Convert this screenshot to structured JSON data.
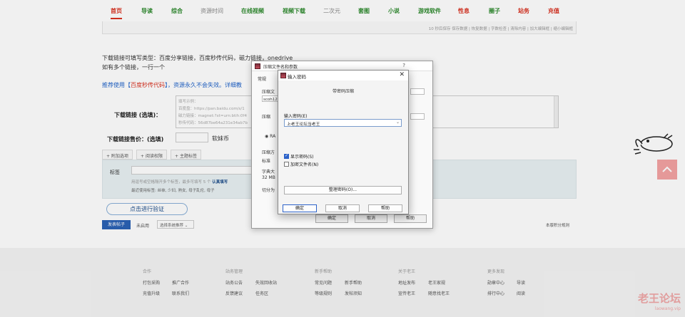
{
  "nav": {
    "items": [
      "首页",
      "导读",
      "综合",
      "资源时间",
      "在线视频",
      "视频下载",
      "二次元",
      "套图",
      "小说",
      "游戏软件",
      "性息",
      "圈子",
      "站务",
      "充值"
    ]
  },
  "topbox": {
    "links": "10 秒后保存 保存数据 | 恢复数据 | 字数检查 | 清除内容 | 加大编辑框 | 缩小编辑框"
  },
  "description": {
    "line1": "下载链接可填写类型：百度分享链接，百度秒传代码，磁力链接，onedrive",
    "line2": "如有多个链接，一行一个"
  },
  "recommend": {
    "prefix": "推荐使用【",
    "link": "百度秒传代码",
    "suffix": "】，资源永久不会失效。详细教"
  },
  "download_link": {
    "label": "下载链接 (选填)：",
    "placeholder_lines": [
      "填写示例：",
      "百度盘：https://pan.baidu.com/s/1",
      "磁力链接：magnet:?xt=urn:btih:0f4",
      "秒传代码：56d87be64a231e34ab7b"
    ]
  },
  "price": {
    "label": "下载链接售价：(选填)",
    "unit": "软妹币"
  },
  "tabs": [
    "附加选项",
    "阅读权限",
    "主题标签"
  ],
  "tags": {
    "label": "标签",
    "hint1": "用逗号或空格隔开多个标签，最多可填写 5 个",
    "hint1_strong": "认真填写",
    "hint2": "最近使用标签: 丝袜, 少妇, 熟女, 母子乱伦, 母子"
  },
  "verify_button": "点击进行验证",
  "post_button": "发表帖子",
  "unlisted_label": "未启用",
  "select_value": "选择系统推荐",
  "rules_link": "本版积分规则",
  "footer": {
    "columns": [
      {
        "title": "合作",
        "links": [
          "打包采购",
          "推广合作",
          "充值升级",
          "联系我们"
        ]
      },
      {
        "title": "站务管理",
        "links": [
          "站务公告",
          "失效回收站",
          "反馈建议",
          "任务区"
        ]
      },
      {
        "title": "新手帮助",
        "links": [
          "常见问题",
          "新手帮助",
          "等级规则",
          "发帖须知"
        ]
      },
      {
        "title": "关于老王",
        "links": [
          "地址发布",
          "老王家规",
          "宣传老王",
          "随意找老王"
        ]
      },
      {
        "title": "更多发现",
        "links": [
          "勋章中心",
          "导读",
          "排行中心",
          "阅读"
        ]
      }
    ]
  },
  "watermark": {
    "main": "老王论坛",
    "sub": "laowang.vip"
  },
  "back_dialog": {
    "title": "压缩文件名和参数",
    "help": "?",
    "tab": "常规",
    "field1_label": "压缩文",
    "field1_value": "scoh12",
    "field2_label": "压缩",
    "radio_label": "RA",
    "field3_label": "压缩方",
    "field3_value": "标准",
    "field4_label": "字典大",
    "field4_value": "32 MB",
    "field5_label": "切分为",
    "ok": "确定",
    "cancel": "取消",
    "help_btn": "帮助"
  },
  "dialog": {
    "title": "输入密码",
    "subtitle": "带密码压缩",
    "password_label": "输入密码(E)",
    "password_value": "上老王论坛当老王",
    "show_password": "显示密码(S)",
    "encrypt_names": "加密文件名(N)",
    "show_password_checked": true,
    "encrypt_names_checked": false,
    "manage_button": "整理密码(O)...",
    "ok": "确定",
    "cancel": "取消",
    "help": "帮助"
  },
  "colors": {
    "nav_green": "#2d8a2d",
    "nav_red": "#d9301f",
    "link_blue": "#1f62c9",
    "panel_bg": "#e8f1f3",
    "accent_blue": "#2c62c9"
  }
}
